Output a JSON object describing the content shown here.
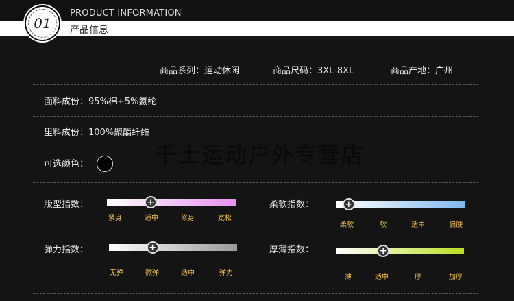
{
  "header": {
    "badge_number": "01",
    "title_en": "PRODUCT INFORMATION",
    "title_cn": "产品信息"
  },
  "summary": {
    "series": "商品系列：运动休闲",
    "size": "商品尺码：3XL-8XL",
    "origin": "商品产地：广州"
  },
  "fabric": "面料成份：95%棉+5%氨纶",
  "lining": "里料成份：100%聚酯纤维",
  "colors_label": "可选颜色：",
  "watermark": "千士运动户外专营店",
  "metrics": {
    "fit": {
      "label": "版型指数：",
      "ticks": [
        "紧身",
        "适中",
        "修身",
        "宽松"
      ],
      "level": 0.34
    },
    "softness": {
      "label": "柔软指数：",
      "ticks": [
        "柔软",
        "软",
        "适中",
        "偏硬"
      ],
      "level": 0.1
    },
    "elasticity": {
      "label": "弹力指数：",
      "ticks": [
        "无弹",
        "微弹",
        "适中",
        "弹力"
      ],
      "level": 0.34
    },
    "thickness": {
      "label": "厚薄指数：",
      "ticks": [
        "薄",
        "适中",
        "厚",
        "加厚"
      ],
      "level": 0.37
    }
  },
  "colors": {
    "accent_tick": "#f0c04a",
    "fit_gradient_end": "#e890f0",
    "softness_gradient_end": "#80b8f0",
    "elasticity_gradient_end": "#9a9a9a",
    "thickness_gradient_end": "#b8e020"
  }
}
